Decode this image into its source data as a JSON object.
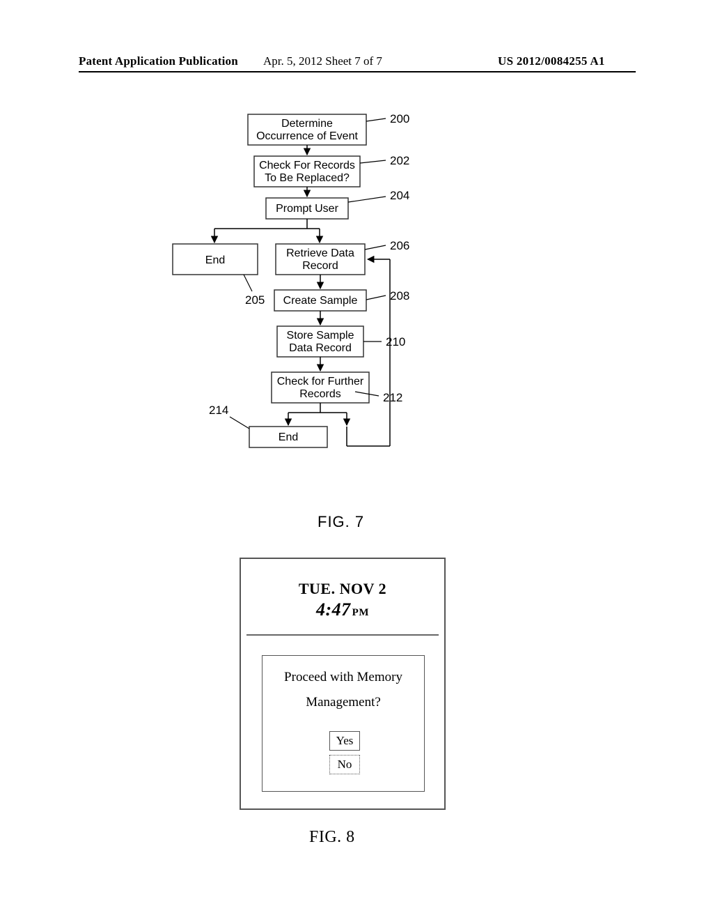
{
  "header": {
    "left": "Patent Application Publication",
    "middle": "Apr. 5, 2012  Sheet 7 of 7",
    "right": "US 2012/0084255 A1"
  },
  "fig7": {
    "caption": "FIG. 7",
    "boxes": {
      "b200": {
        "line1": "Determine",
        "line2": "Occurrence of Event",
        "ref": "200"
      },
      "b202": {
        "line1": "Check For Records",
        "line2": "To Be Replaced?",
        "ref": "202"
      },
      "b204": {
        "line1": "Prompt User",
        "ref": "204"
      },
      "b205": {
        "line1": "End",
        "ref": "205"
      },
      "b206": {
        "line1": "Retrieve Data",
        "line2": "Record",
        "ref": "206"
      },
      "b208": {
        "line1": "Create Sample",
        "ref": "208"
      },
      "b210": {
        "line1": "Store Sample",
        "line2": "Data Record",
        "ref": "210"
      },
      "b212": {
        "line1": "Check for Further",
        "line2": "Records",
        "ref": "212"
      },
      "b214": {
        "line1": "End",
        "ref": "214"
      }
    }
  },
  "fig8": {
    "caption": "FIG. 8",
    "date": "TUE. NOV 2",
    "time": "4:47",
    "ampm": "PM",
    "prompt_line1": "Proceed with Memory",
    "prompt_line2": "Management?",
    "yes": "Yes",
    "no": "No"
  }
}
